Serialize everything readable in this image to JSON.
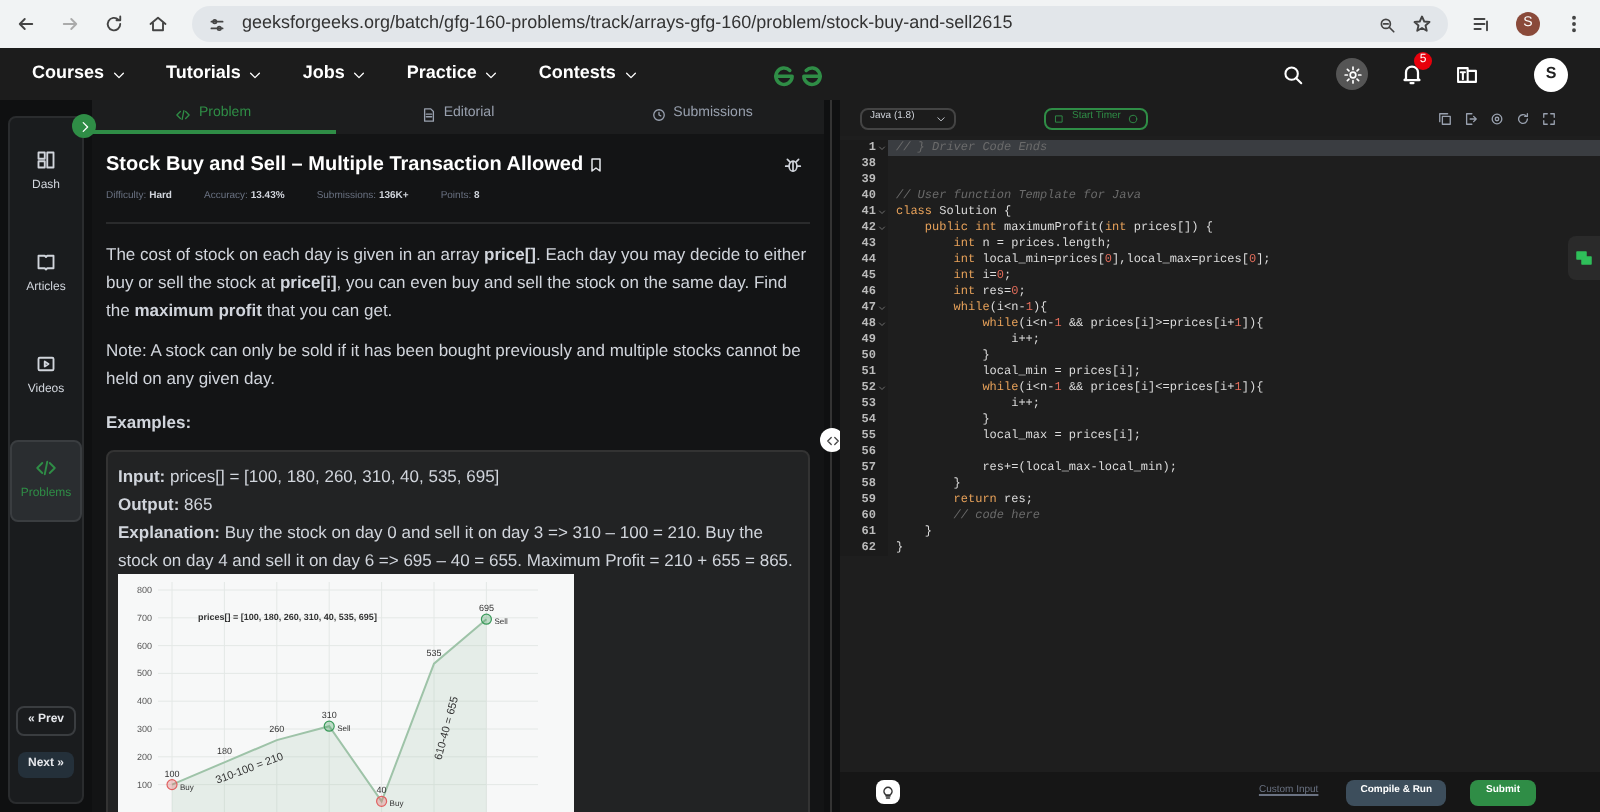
{
  "browser": {
    "url": "geeksforgeeks.org/batch/gfg-160-problems/track/arrays-gfg-160/problem/stock-buy-and-sell2615",
    "profile": "S"
  },
  "nav": {
    "menus": [
      "Courses",
      "Tutorials",
      "Jobs",
      "Practice",
      "Contests"
    ],
    "notification_count": "5",
    "avatar": "S"
  },
  "sidebar": {
    "items": [
      {
        "label": "Dash",
        "selected": false
      },
      {
        "label": "Articles",
        "selected": false
      },
      {
        "label": "Videos",
        "selected": false
      },
      {
        "label": "Problems",
        "selected": true
      }
    ],
    "prev": "« Prev",
    "next": "Next »"
  },
  "tabs": [
    {
      "label": "Problem",
      "selected": true
    },
    {
      "label": "Editorial",
      "selected": false
    },
    {
      "label": "Submissions",
      "selected": false
    }
  ],
  "problem": {
    "title": "Stock Buy and Sell – Multiple Transaction Allowed",
    "meta": [
      {
        "label": "Difficulty:",
        "value": "Hard"
      },
      {
        "label": "Accuracy:",
        "value": "13.43%"
      },
      {
        "label": "Submissions:",
        "value": "136K+"
      },
      {
        "label": "Points:",
        "value": "8"
      }
    ],
    "description": "The cost of stock on each day is given in an array **price[]**. Each day you may decide to either buy or sell the stock at **price[i]**, you can even buy and sell the stock on the same day. Find the **maximum profit** that you can get.",
    "note": "Note: A stock can only be sold if it has been bought previously and multiple stocks cannot be held on any given day.",
    "examples_heading": "Examples:",
    "example": {
      "input": "**Input:** prices[] = [100, 180, 260, 310, 40, 535, 695]",
      "output": "**Output:** 865",
      "explanation": "**Explanation:** Buy the stock on day 0 and sell it on day 3 => 310 – 100 = 210. Buy the stock on day 4 and sell it on day 6 => 695 – 40 = 655. Maximum Profit = 210 + 655 = 865.",
      "chart_data": {
        "type": "area",
        "title": "prices[] = [100, 180, 260, 310, 40, 535, 695]",
        "series": [
          {
            "color": "#9ec3a8",
            "values": [
              100,
              180,
              260,
              310,
              40,
              535,
              695
            ]
          }
        ],
        "ylim": [
          0,
          800
        ],
        "yticks": [
          100,
          200,
          300,
          400,
          500,
          600,
          700,
          800
        ],
        "grid": true,
        "data_labels": true,
        "annotations": [
          {
            "text": "Buy"
          },
          {
            "text": "Sell"
          },
          {
            "text": "Buy"
          },
          {
            "text": "Sell"
          },
          {
            "text": "310-100 = 210"
          },
          {
            "text": "610-40 = 655"
          }
        ]
      }
    }
  },
  "editor": {
    "language": "Java (1.8)",
    "timer": "Start Timer",
    "lines": [
      {
        "number": "1",
        "active": true,
        "foldable": true,
        "tokens": [
          {
            "kind": "comment",
            "text": "// } Driver Code Ends"
          }
        ]
      },
      {
        "number": "38",
        "active": false,
        "foldable": false
      },
      {
        "number": "39",
        "active": false,
        "foldable": false
      },
      {
        "number": "40",
        "active": false,
        "foldable": false,
        "tokens": [
          {
            "kind": "comment",
            "text": "// User function Template for Java"
          }
        ]
      },
      {
        "number": "41",
        "active": false,
        "foldable": true,
        "tokens": [
          {
            "kind": "keyword",
            "text": "class"
          },
          {
            "kind": "plain",
            "text": " Solution {"
          }
        ]
      },
      {
        "number": "42",
        "active": false,
        "foldable": true,
        "tokens": [
          {
            "kind": "keyword",
            "text": "    public int"
          },
          {
            "kind": "plain",
            "text": " maximumProfit("
          },
          {
            "kind": "keyword",
            "text": "int"
          },
          {
            "kind": "plain",
            "text": " prices[]) {"
          }
        ]
      },
      {
        "number": "43",
        "active": false,
        "foldable": false,
        "tokens": [
          {
            "kind": "keyword",
            "text": "        int"
          },
          {
            "kind": "plain",
            "text": " n = prices.length;"
          }
        ]
      },
      {
        "number": "44",
        "active": false,
        "foldable": false,
        "tokens": [
          {
            "kind": "keyword",
            "text": "        int"
          },
          {
            "kind": "plain",
            "text": " local_min=prices["
          },
          {
            "kind": "number",
            "text": "0"
          },
          {
            "kind": "plain",
            "text": "],local_max=prices["
          },
          {
            "kind": "number",
            "text": "0"
          },
          {
            "kind": "plain",
            "text": "];"
          }
        ]
      },
      {
        "number": "45",
        "active": false,
        "foldable": false,
        "tokens": [
          {
            "kind": "keyword",
            "text": "        int"
          },
          {
            "kind": "plain",
            "text": " i="
          },
          {
            "kind": "number",
            "text": "0"
          },
          {
            "kind": "plain",
            "text": ";"
          }
        ]
      },
      {
        "number": "46",
        "active": false,
        "foldable": false,
        "tokens": [
          {
            "kind": "keyword",
            "text": "        int"
          },
          {
            "kind": "plain",
            "text": " res="
          },
          {
            "kind": "number",
            "text": "0"
          },
          {
            "kind": "plain",
            "text": ";"
          }
        ]
      },
      {
        "number": "47",
        "active": false,
        "foldable": true,
        "tokens": [
          {
            "kind": "keyword",
            "text": "        while"
          },
          {
            "kind": "plain",
            "text": "(i<n-"
          },
          {
            "kind": "number",
            "text": "1"
          },
          {
            "kind": "plain",
            "text": "){"
          }
        ]
      },
      {
        "number": "48",
        "active": false,
        "foldable": true,
        "tokens": [
          {
            "kind": "keyword",
            "text": "            while"
          },
          {
            "kind": "plain",
            "text": "(i<n-"
          },
          {
            "kind": "number",
            "text": "1"
          },
          {
            "kind": "plain",
            "text": " && prices[i]>=prices[i+"
          },
          {
            "kind": "number",
            "text": "1"
          },
          {
            "kind": "plain",
            "text": "]){"
          }
        ]
      },
      {
        "number": "49",
        "active": false,
        "foldable": false,
        "tokens": [
          {
            "kind": "plain",
            "text": "                i++;"
          }
        ]
      },
      {
        "number": "50",
        "active": false,
        "foldable": false,
        "tokens": [
          {
            "kind": "plain",
            "text": "            }"
          }
        ]
      },
      {
        "number": "51",
        "active": false,
        "foldable": false,
        "tokens": [
          {
            "kind": "plain",
            "text": "            local_min = prices[i];"
          }
        ]
      },
      {
        "number": "52",
        "active": false,
        "foldable": true,
        "tokens": [
          {
            "kind": "keyword",
            "text": "            while"
          },
          {
            "kind": "plain",
            "text": "(i<n-"
          },
          {
            "kind": "number",
            "text": "1"
          },
          {
            "kind": "plain",
            "text": " && prices[i]<=prices[i+"
          },
          {
            "kind": "number",
            "text": "1"
          },
          {
            "kind": "plain",
            "text": "]){"
          }
        ]
      },
      {
        "number": "53",
        "active": false,
        "foldable": false,
        "tokens": [
          {
            "kind": "plain",
            "text": "                i++;"
          }
        ]
      },
      {
        "number": "54",
        "active": false,
        "foldable": false,
        "tokens": [
          {
            "kind": "plain",
            "text": "            }"
          }
        ]
      },
      {
        "number": "55",
        "active": false,
        "foldable": false,
        "tokens": [
          {
            "kind": "plain",
            "text": "            local_max = prices[i];"
          }
        ]
      },
      {
        "number": "56",
        "active": false,
        "foldable": false
      },
      {
        "number": "57",
        "active": false,
        "foldable": false,
        "tokens": [
          {
            "kind": "plain",
            "text": "            res+=(local_max-local_min);"
          }
        ]
      },
      {
        "number": "58",
        "active": false,
        "foldable": false,
        "tokens": [
          {
            "kind": "plain",
            "text": "        }"
          }
        ]
      },
      {
        "number": "59",
        "active": false,
        "foldable": false,
        "tokens": [
          {
            "kind": "keyword",
            "text": "        return"
          },
          {
            "kind": "plain",
            "text": " res;"
          }
        ]
      },
      {
        "number": "60",
        "active": false,
        "foldable": false,
        "tokens": [
          {
            "kind": "comment",
            "text": "        // code here"
          }
        ]
      },
      {
        "number": "61",
        "active": false,
        "foldable": false,
        "tokens": [
          {
            "kind": "plain",
            "text": "    }"
          }
        ]
      },
      {
        "number": "62",
        "active": false,
        "foldable": false,
        "tokens": [
          {
            "kind": "plain",
            "text": "}"
          }
        ]
      }
    ],
    "custom_input": "Custom Input",
    "compile": "Compile & Run",
    "submit": "Submit"
  }
}
